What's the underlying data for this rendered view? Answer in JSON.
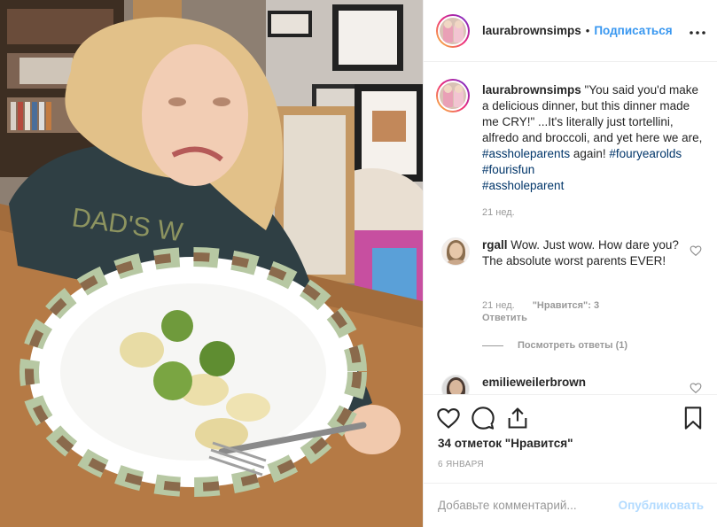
{
  "post": {
    "author": "laurabrownsimps",
    "separator": "•",
    "follow_label": "Подписаться",
    "more_icon": "more-horizontal-icon"
  },
  "caption": {
    "author": "laurabrownsimps",
    "text": " \"You said you'd make a delicious dinner, but this dinner made me CRY!\" ...It's literally just tortellini, alfredo and broccoli, and yet here we are, ",
    "tag1": "#assholeparents",
    "mid": " again! ",
    "tag2": "#fouryearolds",
    "space": " ",
    "tag3": "#fourisfun",
    "tag4": "#assholeparent",
    "time": "21 нед."
  },
  "comments": [
    {
      "author": "rgall",
      "text": " Wow. Just wow. How dare you? The absolute worst parents EVER!",
      "time": "21 нед.",
      "likes": "\"Нравится\": 3",
      "reply_label": "Ответить",
      "view_replies": "Посмотреть ответы (1)"
    },
    {
      "author": "emilieweilerbrown",
      "text": ""
    }
  ],
  "actions": {
    "likes_count": "34 отметок \"Нравится\"",
    "date": "6 ЯНВАРЯ"
  },
  "add_comment": {
    "placeholder": "Добавьте комментарий...",
    "publish_label": "Опубликовать"
  },
  "colors": {
    "accent": "#3897f0",
    "hashtag": "#003569",
    "muted": "#999999"
  }
}
